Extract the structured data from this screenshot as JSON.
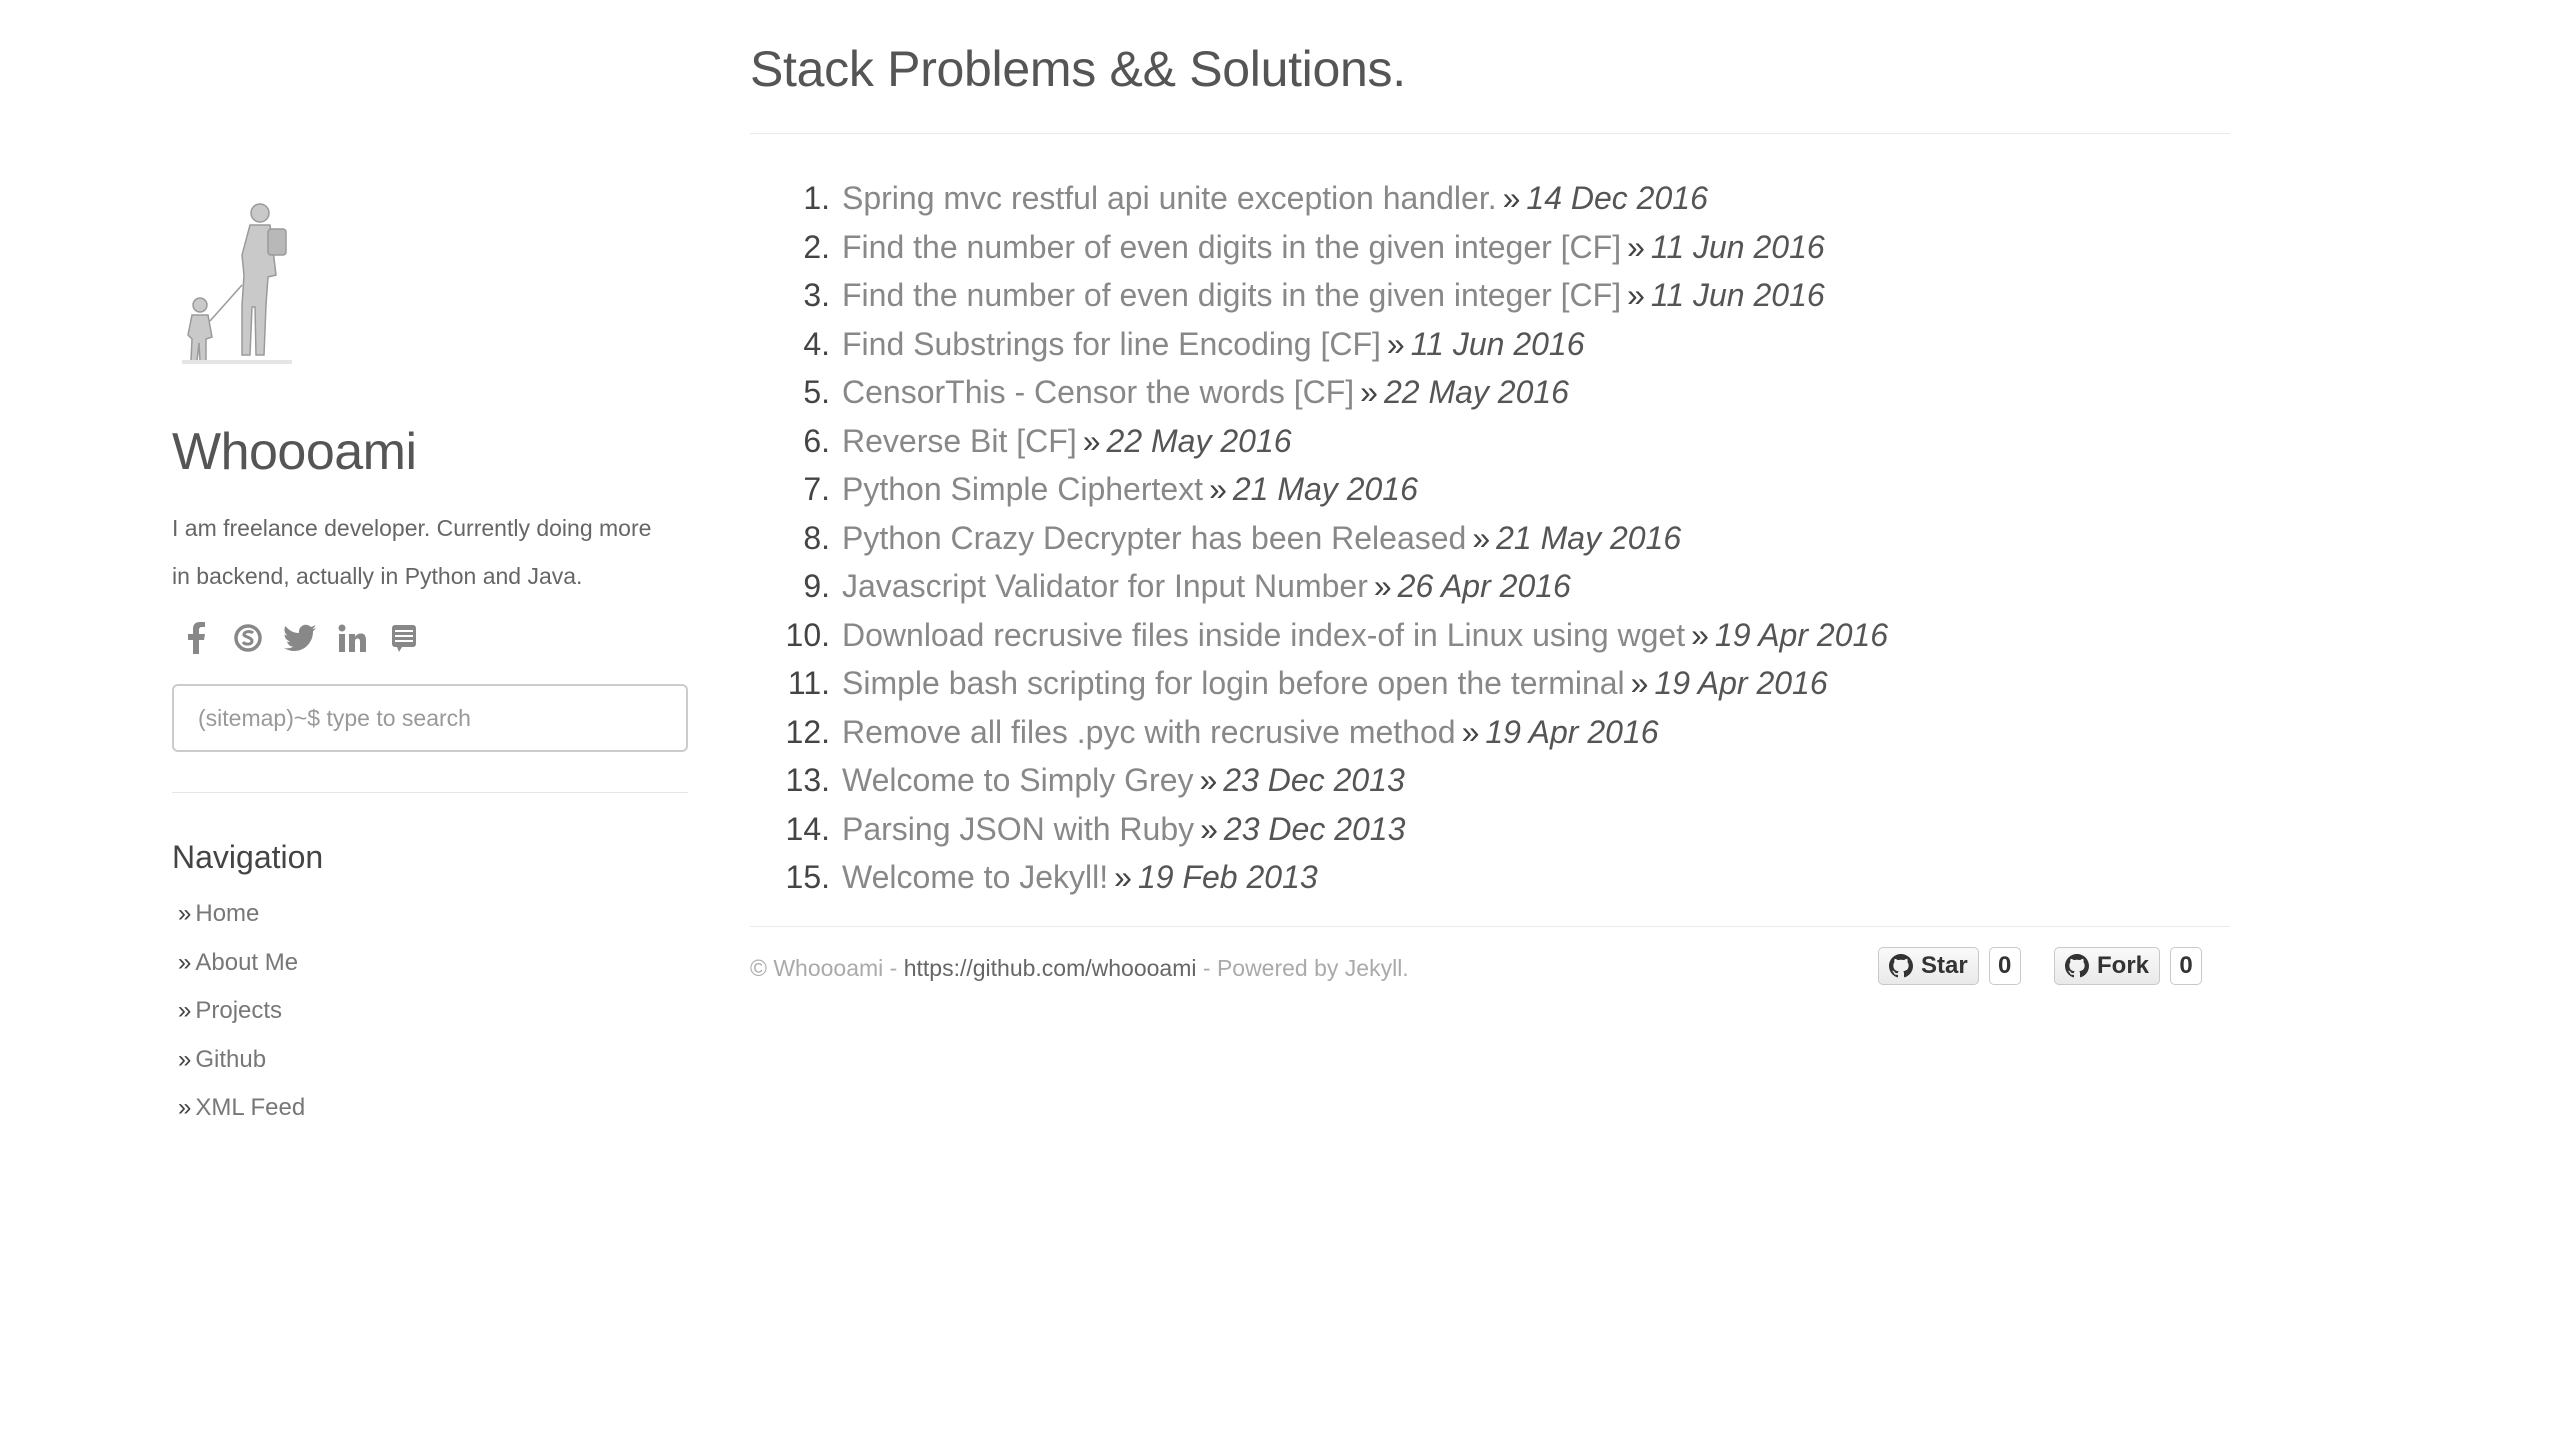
{
  "sidebar": {
    "site_name": "Whoooami",
    "bio": "I am freelance developer. Currently doing more in backend, actually in Python and Java.",
    "social_icons": [
      "facebook-icon",
      "skype-icon",
      "twitter-icon",
      "linkedin-icon",
      "feed-icon"
    ],
    "search_placeholder": "(sitemap)~$ type to search",
    "nav_title": "Navigation",
    "nav_prefix": "»",
    "nav_items": [
      "Home",
      "About Me",
      "Projects",
      "Github",
      "XML Feed"
    ]
  },
  "main": {
    "page_title": "Stack Problems && Solutions.",
    "separator": "»",
    "posts": [
      {
        "num": "1.",
        "title": "Spring mvc restful api unite exception handler.",
        "date": "14 Dec 2016"
      },
      {
        "num": "2.",
        "title": "Find the number of even digits in the given integer [CF]",
        "date": "11 Jun 2016"
      },
      {
        "num": "3.",
        "title": "Find the number of even digits in the given integer [CF]",
        "date": "11 Jun 2016"
      },
      {
        "num": "4.",
        "title": "Find Substrings for line Encoding [CF]",
        "date": "11 Jun 2016"
      },
      {
        "num": "5.",
        "title": "CensorThis - Censor the words [CF]",
        "date": "22 May 2016"
      },
      {
        "num": "6.",
        "title": "Reverse Bit [CF]",
        "date": "22 May 2016"
      },
      {
        "num": "7.",
        "title": "Python Simple Ciphertext",
        "date": "21 May 2016"
      },
      {
        "num": "8.",
        "title": "Python Crazy Decrypter has been Released",
        "date": "21 May 2016"
      },
      {
        "num": "9.",
        "title": "Javascript Validator for Input Number",
        "date": "26 Apr 2016"
      },
      {
        "num": "10.",
        "title": "Download recrusive files inside index-of in Linux using wget",
        "date": "19 Apr 2016"
      },
      {
        "num": "11.",
        "title": "Simple bash scripting for login before open the terminal",
        "date": "19 Apr 2016"
      },
      {
        "num": "12.",
        "title": "Remove all files .pyc with recrusive method",
        "date": "19 Apr 2016"
      },
      {
        "num": "13.",
        "title": "Welcome to Simply Grey",
        "date": "23 Dec 2013"
      },
      {
        "num": "14.",
        "title": "Parsing JSON with Ruby",
        "date": "23 Dec 2013"
      },
      {
        "num": "15.",
        "title": "Welcome to Jekyll!",
        "date": "19 Feb 2013"
      }
    ]
  },
  "footer": {
    "copy_prefix": "© Whoooami - ",
    "link": "https://github.com/whoooami",
    "copy_suffix": " - Powered by Jekyll.",
    "star_label": "Star",
    "star_count": "0",
    "fork_label": "Fork",
    "fork_count": "0"
  }
}
